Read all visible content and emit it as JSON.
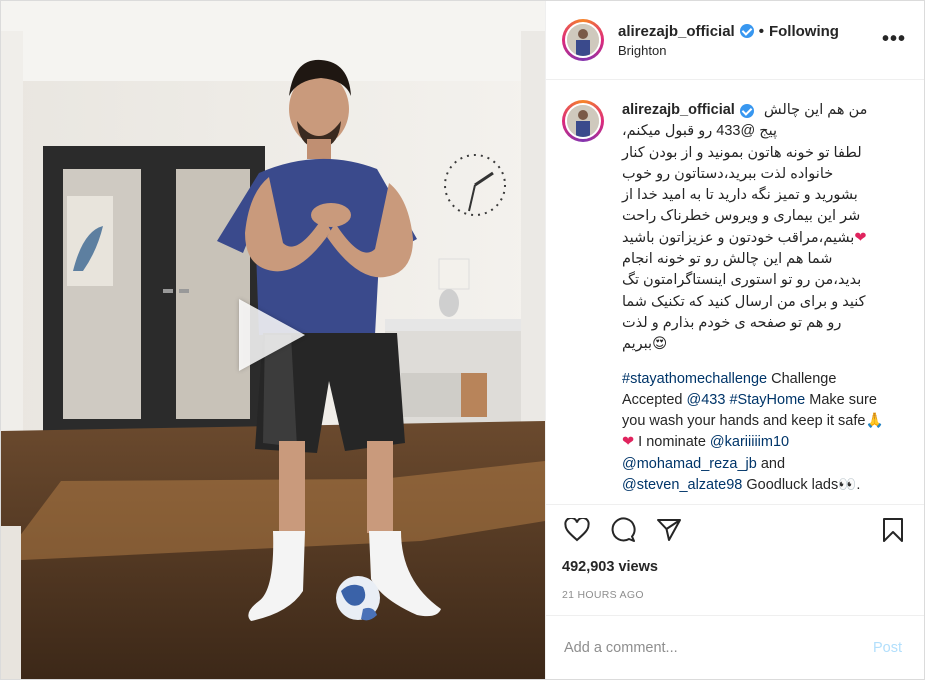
{
  "header": {
    "username": "alirezajb_official",
    "separator": "•",
    "follow_status": "Following",
    "location": "Brighton",
    "more_label": "•••"
  },
  "caption": {
    "username": "alirezajb_official",
    "fa_lines": [
      "من هم این چالش",
      "پیج @433 رو قبول میکنم،",
      "لطفا تو خونه هاتون بمونید و از بودن کنار",
      "خانواده لذت ببرید،دستاتون رو خوب",
      "بشورید و تمیز نگه دارید تا به امید خدا از",
      "شر این بیماری و ویروس خطرناک راحت",
      "بشیم،مراقب خودتون و عزیزاتون باشید",
      "شما هم این چالش رو تو خونه انجام",
      "بدید،من رو تو استوری اینستاگرامتون تگ",
      "کنید و برای من ارسال کنید که تکنیک شما",
      "رو هم تو صفحه ی خودم بذارم و لذت",
      "ببریم"
    ],
    "en": {
      "tag1": "#stayathomechallenge",
      "t1": " Challenge Accepted ",
      "mention1": "@433",
      "t2": " ",
      "tag2": "#StayHome",
      "t3": " Make sure you wash your hands and keep it safe",
      "t4": " I nominate ",
      "mention2": "@kariiiiim10",
      "t5": " ",
      "mention3": "@mohamad_reza_jb",
      "t6": " and ",
      "mention4": "@steven_alzate98",
      "t7": " Goodluck lads",
      "t8": "."
    }
  },
  "stats": {
    "views": "492,903 views",
    "time": "21 HOURS AGO"
  },
  "comment": {
    "placeholder": "Add a comment...",
    "post_label": "Post"
  },
  "icons": {
    "like": "heart-outline-icon",
    "comment": "comment-bubble-icon",
    "share": "paper-plane-icon",
    "save": "bookmark-icon",
    "play": "play-icon"
  },
  "colors": {
    "verified": "#3897f0",
    "link": "#003569",
    "heart": "#e0245e",
    "post_button": "#b2dffc",
    "muted": "#8e8e8e"
  }
}
